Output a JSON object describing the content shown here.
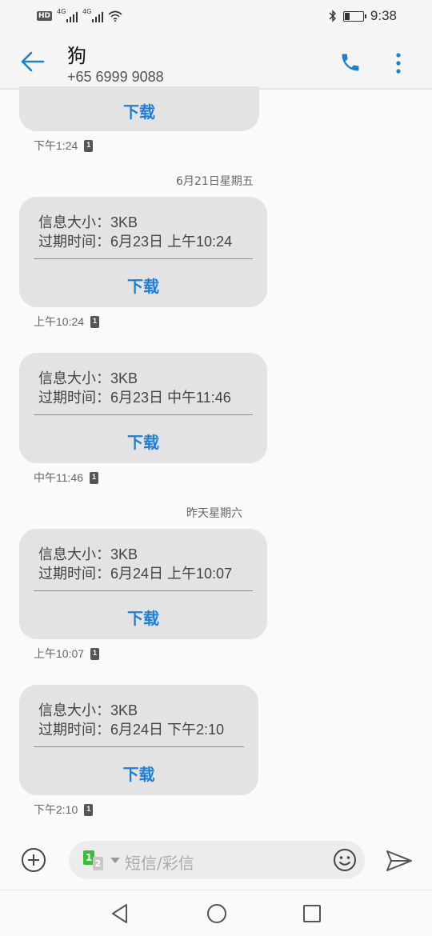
{
  "status_bar": {
    "hd_label": "HD",
    "network_1": "4G",
    "network_2": "4G",
    "time": "9:38"
  },
  "header": {
    "contact_name": "狗",
    "contact_number": "+65 6999 9088"
  },
  "messages": [
    {
      "download_label": "下载",
      "timestamp": "下午1:24",
      "sim": "1"
    },
    {
      "date_separator": "6月21日星期五",
      "size_line": "信息大小：3KB",
      "expiry_line": "过期时间：6月23日 上午10:24",
      "download_label": "下载",
      "timestamp": "上午10:24",
      "sim": "1"
    },
    {
      "size_line": "信息大小：3KB",
      "expiry_line": "过期时间：6月23日 中午11:46",
      "download_label": "下载",
      "timestamp": "中午11:46",
      "sim": "1"
    },
    {
      "date_separator": "昨天星期六",
      "size_line": "信息大小：3KB",
      "expiry_line": "过期时间：6月24日 上午10:07",
      "download_label": "下载",
      "timestamp": "上午10:07",
      "sim": "1"
    },
    {
      "size_line": "信息大小：3KB",
      "expiry_line": "过期时间：6月24日 下午2:10",
      "download_label": "下载",
      "timestamp": "下午2:10",
      "sim": "1"
    }
  ],
  "composer": {
    "sim_primary": "1",
    "sim_secondary": "2",
    "placeholder": "短信/彩信"
  },
  "colors": {
    "accent": "#1e7fd8",
    "bubble": "#e3e3e3",
    "sim_green": "#3dbb3d"
  },
  "icons": [
    "back-arrow-icon",
    "phone-icon",
    "more-vertical-icon",
    "add-icon",
    "emoji-icon",
    "send-icon",
    "nav-back-icon",
    "nav-home-icon",
    "nav-recents-icon"
  ]
}
